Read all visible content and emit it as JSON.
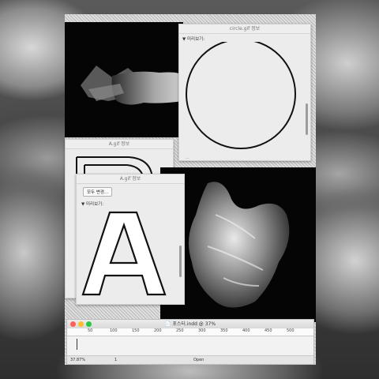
{
  "circle_window": {
    "title": "circle.gif 정보",
    "section": "▼ 미리보기:",
    "footer": "..."
  },
  "a_window_back": {
    "title": "A.gif 정보"
  },
  "a_window_front": {
    "title": "A.gif 정보",
    "button": "모두 변경...",
    "section": "▼ 미리보기:"
  },
  "indesign": {
    "title": "📄 포스터.indd @ 37%",
    "ruler_labels": [
      "50",
      "100",
      "150",
      "200",
      "250",
      "300",
      "350",
      "400",
      "450",
      "500"
    ],
    "zoom": "37.87%",
    "page": "1",
    "status_open": "Open"
  },
  "colors": {
    "close": "#ff5f57",
    "minimize": "#ffbd2e",
    "zoom": "#28c840"
  }
}
